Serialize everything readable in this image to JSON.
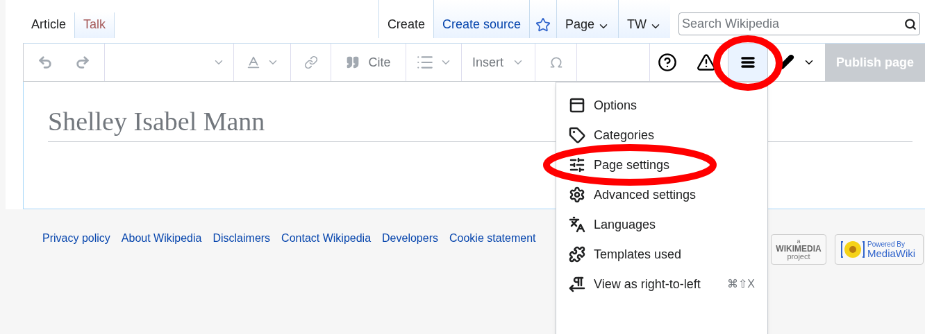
{
  "tabs": [
    {
      "label": "Article",
      "selected": true
    },
    {
      "label": "Talk",
      "selected": false
    }
  ],
  "actions": [
    {
      "kind": "text",
      "label": "Create",
      "selected": true
    },
    {
      "kind": "text",
      "label": "Create source",
      "selected": false
    },
    {
      "kind": "star",
      "selected": false
    },
    {
      "kind": "dropdown",
      "label": "Page",
      "selected": false
    },
    {
      "kind": "dropdown",
      "label": "TW",
      "selected": false
    }
  ],
  "search": {
    "placeholder": "Search Wikipedia"
  },
  "toolbar": [
    {
      "kind": "history"
    },
    {
      "kind": "format"
    },
    {
      "kind": "style"
    },
    {
      "kind": "link"
    },
    {
      "kind": "cite",
      "label": "Cite"
    },
    {
      "kind": "list"
    },
    {
      "kind": "insert",
      "label": "Insert"
    },
    {
      "kind": "special"
    },
    {
      "kind": "spacer"
    },
    {
      "kind": "help"
    },
    {
      "kind": "notices"
    },
    {
      "kind": "menu",
      "expanded": true,
      "circled": true
    },
    {
      "kind": "mode"
    },
    {
      "kind": "publish",
      "label": "Publish page",
      "disabled": true
    }
  ],
  "title": "Shelley Isabel Mann",
  "footer_links": [
    "Privacy policy",
    "About Wikipedia",
    "Disclaimers",
    "Contact Wikipedia",
    "Developers",
    "Cookie statement"
  ],
  "logos": [
    {
      "kind": "wikimedia",
      "small": "a",
      "name": "WIKIMEDIA",
      "sub": "project"
    },
    {
      "kind": "mediawiki",
      "small": "Powered By",
      "name": "MediaWiki"
    }
  ],
  "menu": [
    {
      "kind": "options",
      "label": "Options",
      "circled": false
    },
    {
      "kind": "categories",
      "label": "Categories",
      "circled": false
    },
    {
      "kind": "settings",
      "label": "Page settings",
      "circled": true
    },
    {
      "kind": "advanced",
      "label": "Advanced settings",
      "circled": false
    },
    {
      "kind": "languages",
      "label": "Languages",
      "circled": false
    },
    {
      "kind": "templates",
      "label": "Templates used",
      "circled": false
    },
    {
      "kind": "direction",
      "label": "View as right-to-left",
      "shortcut": "⌘⇧X",
      "circled": false
    }
  ]
}
